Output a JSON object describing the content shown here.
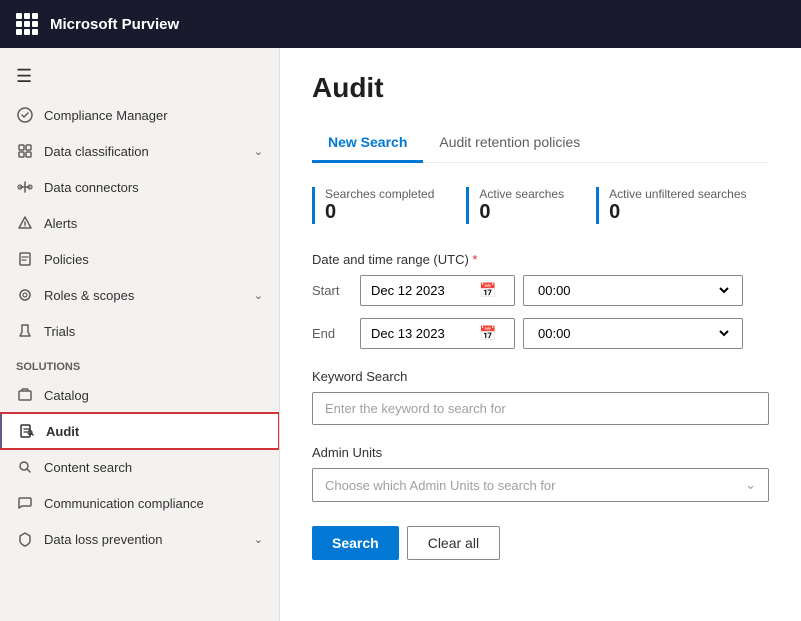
{
  "topbar": {
    "title": "Microsoft Purview"
  },
  "sidebar": {
    "hamburger": "☰",
    "items": [
      {
        "id": "compliance-manager",
        "label": "Compliance Manager",
        "icon": "🏆",
        "hasChevron": false
      },
      {
        "id": "data-classification",
        "label": "Data classification",
        "icon": "🏷",
        "hasChevron": true
      },
      {
        "id": "data-connectors",
        "label": "Data connectors",
        "icon": "🔌",
        "hasChevron": false
      },
      {
        "id": "alerts",
        "label": "Alerts",
        "icon": "🔔",
        "hasChevron": false
      },
      {
        "id": "policies",
        "label": "Policies",
        "icon": "📋",
        "hasChevron": false
      },
      {
        "id": "roles-scopes",
        "label": "Roles & scopes",
        "icon": "🔍",
        "hasChevron": true
      },
      {
        "id": "trials",
        "label": "Trials",
        "icon": "🧪",
        "hasChevron": false
      }
    ],
    "solutions_label": "Solutions",
    "solutions_items": [
      {
        "id": "catalog",
        "label": "Catalog",
        "icon": "📦",
        "hasChevron": false
      },
      {
        "id": "audit",
        "label": "Audit",
        "icon": "📄",
        "hasChevron": false,
        "active": true
      },
      {
        "id": "content-search",
        "label": "Content search",
        "icon": "🔎",
        "hasChevron": false
      },
      {
        "id": "communication-compliance",
        "label": "Communication compliance",
        "icon": "💬",
        "hasChevron": false
      },
      {
        "id": "data-loss-prevention",
        "label": "Data loss prevention",
        "icon": "🛡",
        "hasChevron": true
      }
    ]
  },
  "content": {
    "page_title": "Audit",
    "tabs": [
      {
        "id": "new-search",
        "label": "New Search",
        "active": true
      },
      {
        "id": "audit-retention",
        "label": "Audit retention policies",
        "active": false
      }
    ],
    "stats": [
      {
        "id": "searches-completed",
        "label": "Searches completed",
        "value": "0"
      },
      {
        "id": "active-searches",
        "label": "Active searches",
        "value": "0"
      },
      {
        "id": "active-unfiltered",
        "label": "Active unfiltered searches",
        "value": "0"
      }
    ],
    "form": {
      "date_time_label": "Date and time range (UTC)",
      "required_marker": "*",
      "start_label": "Start",
      "start_date": "Dec 12 2023",
      "start_time": "00:00",
      "end_label": "End",
      "end_date": "Dec 13 2023",
      "end_time": "00:00",
      "keyword_label": "Keyword Search",
      "keyword_placeholder": "Enter the keyword to search for",
      "admin_units_label": "Admin Units",
      "admin_units_placeholder": "Choose which Admin Units to search for"
    },
    "buttons": {
      "search": "Search",
      "clear_all": "Clear all"
    }
  }
}
